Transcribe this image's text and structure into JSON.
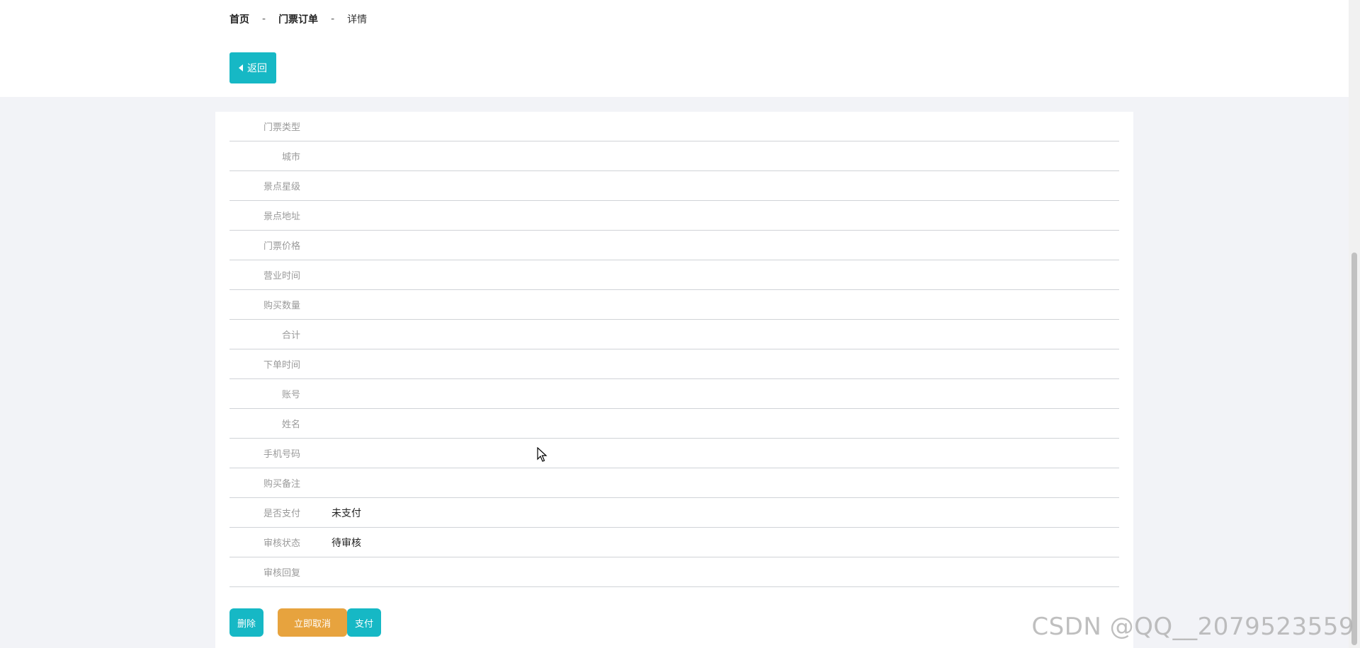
{
  "breadcrumb": {
    "home": "首页",
    "orders": "门票订单",
    "current": "详情",
    "separator": "-"
  },
  "back_button": {
    "label": "返回"
  },
  "details": [
    {
      "label": "门票类型",
      "value": ""
    },
    {
      "label": "城市",
      "value": ""
    },
    {
      "label": "景点星级",
      "value": ""
    },
    {
      "label": "景点地址",
      "value": ""
    },
    {
      "label": "门票价格",
      "value": ""
    },
    {
      "label": "营业时间",
      "value": ""
    },
    {
      "label": "购买数量",
      "value": ""
    },
    {
      "label": "合计",
      "value": ""
    },
    {
      "label": "下单时间",
      "value": ""
    },
    {
      "label": "账号",
      "value": ""
    },
    {
      "label": "姓名",
      "value": ""
    },
    {
      "label": "手机号码",
      "value": ""
    },
    {
      "label": "购买备注",
      "value": ""
    },
    {
      "label": "是否支付",
      "value": "未支付"
    },
    {
      "label": "审核状态",
      "value": "待审核"
    },
    {
      "label": "审核回复",
      "value": ""
    }
  ],
  "actions": {
    "delete": "删除",
    "cancel": "立即取消",
    "pay": "支付"
  },
  "colors": {
    "primary": "#16b8c5",
    "warning": "#e7a33e",
    "background": "#f2f3f7"
  },
  "watermark": "CSDN @QQ__2079523559"
}
